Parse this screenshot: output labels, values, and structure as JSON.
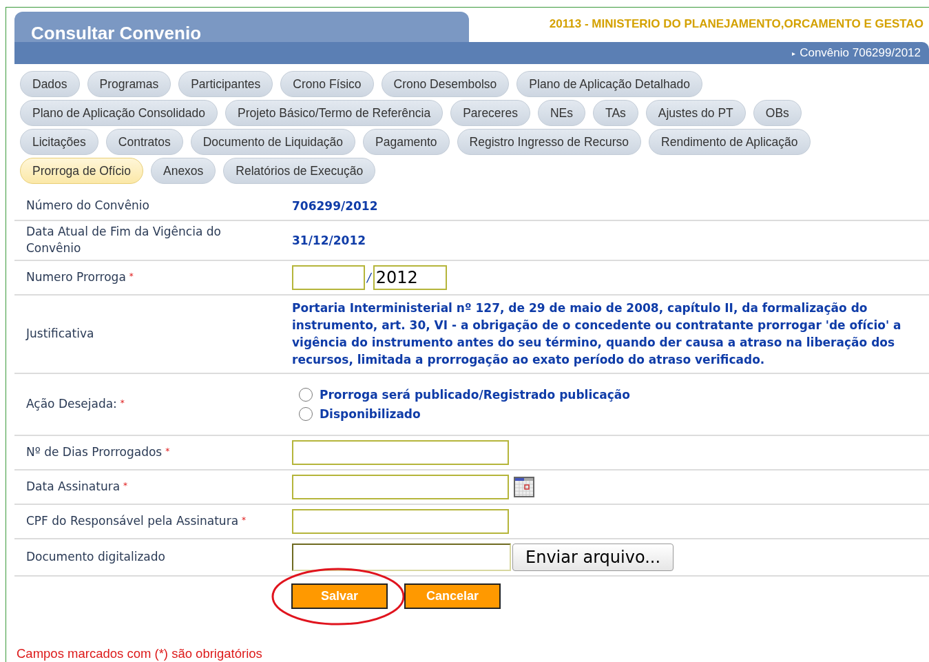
{
  "header": {
    "title": "Consultar Convenio",
    "organ": "20113 - MINISTERIO DO PLANEJAMENTO,ORCAMENTO E GESTAO",
    "breadcrumb_arrow": "▸",
    "breadcrumb": "Convênio 706299/2012"
  },
  "tabs": [
    [
      {
        "label": "Dados",
        "selected": false
      },
      {
        "label": "Programas",
        "selected": false
      },
      {
        "label": "Participantes",
        "selected": false
      },
      {
        "label": "Crono Físico",
        "selected": false
      },
      {
        "label": "Crono Desembolso",
        "selected": false
      },
      {
        "label": "Plano de Aplicação Detalhado",
        "selected": false
      }
    ],
    [
      {
        "label": "Plano de Aplicação Consolidado",
        "selected": false
      },
      {
        "label": "Projeto Básico/Termo de Referência",
        "selected": false
      },
      {
        "label": "Pareceres",
        "selected": false
      },
      {
        "label": "NEs",
        "selected": false
      },
      {
        "label": "TAs",
        "selected": false
      },
      {
        "label": "Ajustes do PT",
        "selected": false
      },
      {
        "label": "OBs",
        "selected": false
      }
    ],
    [
      {
        "label": "Licitações",
        "selected": false
      },
      {
        "label": "Contratos",
        "selected": false
      },
      {
        "label": "Documento de Liquidação",
        "selected": false
      },
      {
        "label": "Pagamento",
        "selected": false
      },
      {
        "label": "Registro Ingresso de Recurso",
        "selected": false
      },
      {
        "label": "Rendimento de Aplicação",
        "selected": false
      }
    ],
    [
      {
        "label": "Prorroga de Ofício",
        "selected": true
      },
      {
        "label": "Anexos",
        "selected": false
      },
      {
        "label": "Relatórios de Execução",
        "selected": false
      }
    ]
  ],
  "fields": [
    {
      "kind": "text",
      "label": "Número do Convênio",
      "value": "706299/2012"
    },
    {
      "kind": "text",
      "label": "Data Atual de Fim da Vigência do Convênio",
      "value": "31/12/2012"
    },
    {
      "kind": "number",
      "label": "Numero Prorroga",
      "required_mark": "*",
      "separator": "/",
      "year": "2012"
    },
    {
      "kind": "note",
      "label": "Justificativa",
      "value": "Portaria Interministerial nº 127, de 29 de maio de 2008, capítulo II, da formalização do instrumento, art. 30, VI - a obrigação de o concedente ou contratante prorrogar 'de ofício' a vigência do instrumento antes do seu término, quando der causa a atraso na liberação dos recursos, limitada a prorrogação ao exato período do atraso verificado."
    },
    {
      "kind": "radio",
      "label": "Ação Desejada:",
      "required_mark": "*",
      "options": [
        {
          "label": "Prorroga será publicado/Registrado publicação",
          "selected": false
        },
        {
          "label": "Disponibilizado",
          "selected": false
        }
      ]
    },
    {
      "kind": "input",
      "label": "Nº de Dias Prorrogados",
      "required_mark": "*"
    },
    {
      "kind": "date",
      "label": "Data Assinatura",
      "required_mark": "*"
    },
    {
      "kind": "input",
      "label": "CPF do Responsável pela Assinatura",
      "required_mark": "*"
    },
    {
      "kind": "file",
      "label": "Documento digitalizado",
      "button": "Enviar arquivo..."
    }
  ],
  "buttons": [
    {
      "label": "Salvar",
      "highlighted": true
    },
    {
      "label": "Cancelar",
      "highlighted": false
    }
  ],
  "footnote": "Campos marcados com (*) são obrigatórios"
}
